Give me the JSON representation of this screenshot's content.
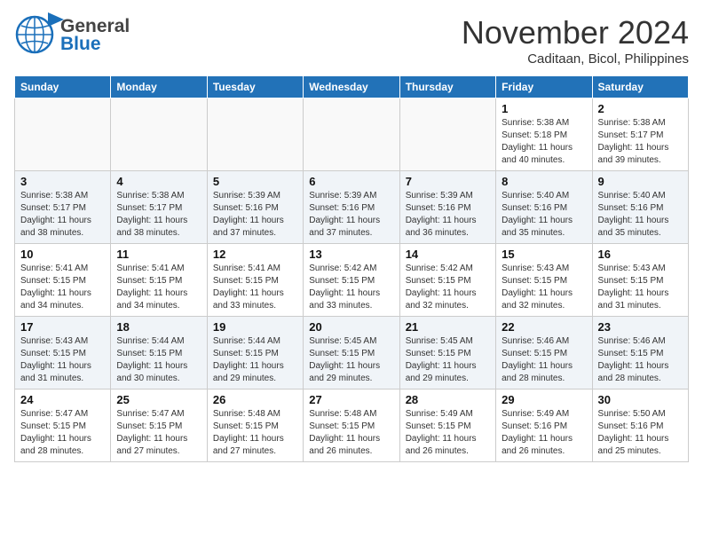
{
  "header": {
    "logo_line1": "General",
    "logo_line2": "Blue",
    "month": "November 2024",
    "location": "Caditaan, Bicol, Philippines"
  },
  "weekdays": [
    "Sunday",
    "Monday",
    "Tuesday",
    "Wednesday",
    "Thursday",
    "Friday",
    "Saturday"
  ],
  "weeks": [
    [
      {
        "day": "",
        "info": ""
      },
      {
        "day": "",
        "info": ""
      },
      {
        "day": "",
        "info": ""
      },
      {
        "day": "",
        "info": ""
      },
      {
        "day": "",
        "info": ""
      },
      {
        "day": "1",
        "info": "Sunrise: 5:38 AM\nSunset: 5:18 PM\nDaylight: 11 hours\nand 40 minutes."
      },
      {
        "day": "2",
        "info": "Sunrise: 5:38 AM\nSunset: 5:17 PM\nDaylight: 11 hours\nand 39 minutes."
      }
    ],
    [
      {
        "day": "3",
        "info": "Sunrise: 5:38 AM\nSunset: 5:17 PM\nDaylight: 11 hours\nand 38 minutes."
      },
      {
        "day": "4",
        "info": "Sunrise: 5:38 AM\nSunset: 5:17 PM\nDaylight: 11 hours\nand 38 minutes."
      },
      {
        "day": "5",
        "info": "Sunrise: 5:39 AM\nSunset: 5:16 PM\nDaylight: 11 hours\nand 37 minutes."
      },
      {
        "day": "6",
        "info": "Sunrise: 5:39 AM\nSunset: 5:16 PM\nDaylight: 11 hours\nand 37 minutes."
      },
      {
        "day": "7",
        "info": "Sunrise: 5:39 AM\nSunset: 5:16 PM\nDaylight: 11 hours\nand 36 minutes."
      },
      {
        "day": "8",
        "info": "Sunrise: 5:40 AM\nSunset: 5:16 PM\nDaylight: 11 hours\nand 35 minutes."
      },
      {
        "day": "9",
        "info": "Sunrise: 5:40 AM\nSunset: 5:16 PM\nDaylight: 11 hours\nand 35 minutes."
      }
    ],
    [
      {
        "day": "10",
        "info": "Sunrise: 5:41 AM\nSunset: 5:15 PM\nDaylight: 11 hours\nand 34 minutes."
      },
      {
        "day": "11",
        "info": "Sunrise: 5:41 AM\nSunset: 5:15 PM\nDaylight: 11 hours\nand 34 minutes."
      },
      {
        "day": "12",
        "info": "Sunrise: 5:41 AM\nSunset: 5:15 PM\nDaylight: 11 hours\nand 33 minutes."
      },
      {
        "day": "13",
        "info": "Sunrise: 5:42 AM\nSunset: 5:15 PM\nDaylight: 11 hours\nand 33 minutes."
      },
      {
        "day": "14",
        "info": "Sunrise: 5:42 AM\nSunset: 5:15 PM\nDaylight: 11 hours\nand 32 minutes."
      },
      {
        "day": "15",
        "info": "Sunrise: 5:43 AM\nSunset: 5:15 PM\nDaylight: 11 hours\nand 32 minutes."
      },
      {
        "day": "16",
        "info": "Sunrise: 5:43 AM\nSunset: 5:15 PM\nDaylight: 11 hours\nand 31 minutes."
      }
    ],
    [
      {
        "day": "17",
        "info": "Sunrise: 5:43 AM\nSunset: 5:15 PM\nDaylight: 11 hours\nand 31 minutes."
      },
      {
        "day": "18",
        "info": "Sunrise: 5:44 AM\nSunset: 5:15 PM\nDaylight: 11 hours\nand 30 minutes."
      },
      {
        "day": "19",
        "info": "Sunrise: 5:44 AM\nSunset: 5:15 PM\nDaylight: 11 hours\nand 29 minutes."
      },
      {
        "day": "20",
        "info": "Sunrise: 5:45 AM\nSunset: 5:15 PM\nDaylight: 11 hours\nand 29 minutes."
      },
      {
        "day": "21",
        "info": "Sunrise: 5:45 AM\nSunset: 5:15 PM\nDaylight: 11 hours\nand 29 minutes."
      },
      {
        "day": "22",
        "info": "Sunrise: 5:46 AM\nSunset: 5:15 PM\nDaylight: 11 hours\nand 28 minutes."
      },
      {
        "day": "23",
        "info": "Sunrise: 5:46 AM\nSunset: 5:15 PM\nDaylight: 11 hours\nand 28 minutes."
      }
    ],
    [
      {
        "day": "24",
        "info": "Sunrise: 5:47 AM\nSunset: 5:15 PM\nDaylight: 11 hours\nand 28 minutes."
      },
      {
        "day": "25",
        "info": "Sunrise: 5:47 AM\nSunset: 5:15 PM\nDaylight: 11 hours\nand 27 minutes."
      },
      {
        "day": "26",
        "info": "Sunrise: 5:48 AM\nSunset: 5:15 PM\nDaylight: 11 hours\nand 27 minutes."
      },
      {
        "day": "27",
        "info": "Sunrise: 5:48 AM\nSunset: 5:15 PM\nDaylight: 11 hours\nand 26 minutes."
      },
      {
        "day": "28",
        "info": "Sunrise: 5:49 AM\nSunset: 5:15 PM\nDaylight: 11 hours\nand 26 minutes."
      },
      {
        "day": "29",
        "info": "Sunrise: 5:49 AM\nSunset: 5:16 PM\nDaylight: 11 hours\nand 26 minutes."
      },
      {
        "day": "30",
        "info": "Sunrise: 5:50 AM\nSunset: 5:16 PM\nDaylight: 11 hours\nand 25 minutes."
      }
    ]
  ]
}
